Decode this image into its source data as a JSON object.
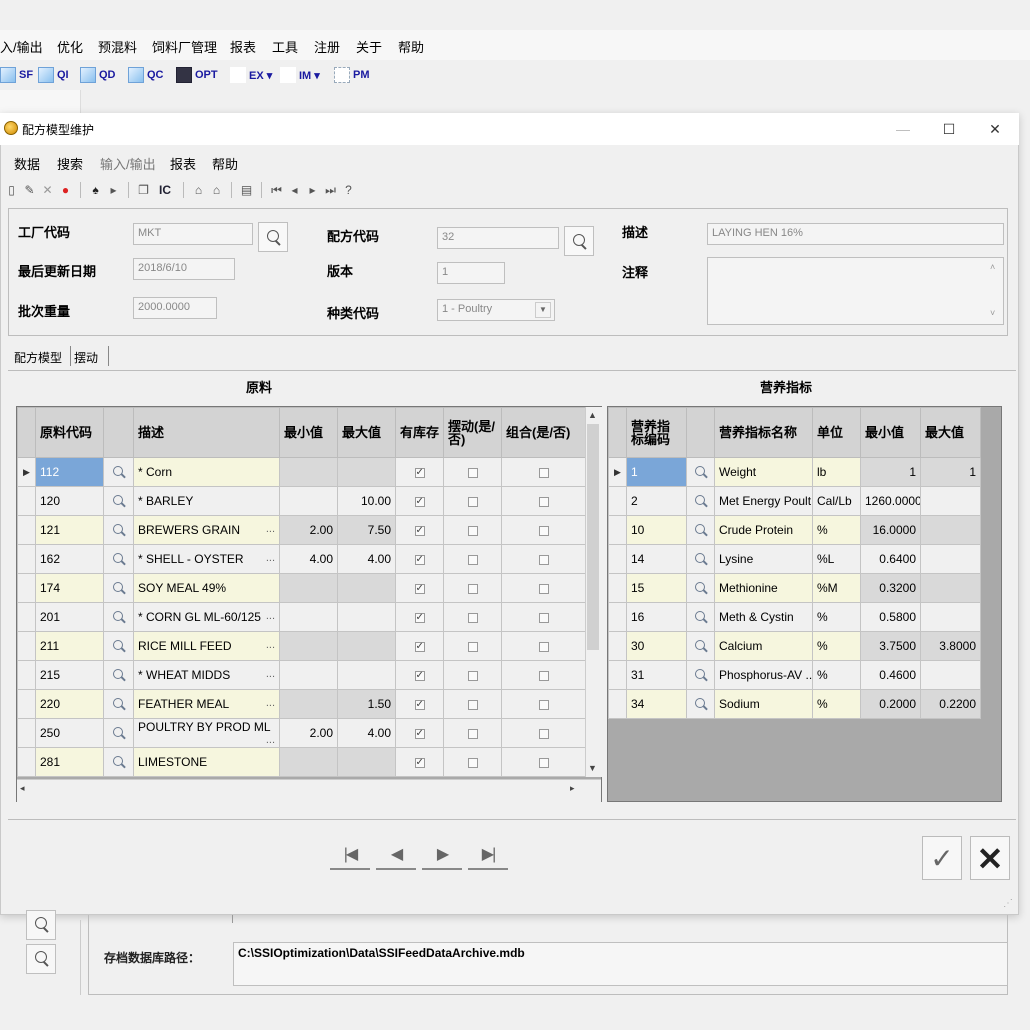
{
  "bg_menu": [
    "入/输出",
    "优化",
    "预混料",
    "饲料厂管理",
    "报表",
    "工具",
    "注册",
    "关于",
    "帮助"
  ],
  "bg_toolbar": [
    "SF",
    "QI",
    "QD",
    "QC",
    "OPT",
    "EX ▾",
    "IM ▾",
    "PM"
  ],
  "dialog": {
    "title": "配方模型维护",
    "menu": [
      "数据",
      "搜索",
      "输入/输出",
      "报表",
      "帮助"
    ],
    "ic_label": "IC"
  },
  "header": {
    "plant_code_label": "工厂代码",
    "plant_code": "MKT",
    "formula_code_label": "配方代码",
    "formula_code": "32",
    "description_label": "描述",
    "description": "LAYING HEN 16%",
    "last_update_label": "最后更新日期",
    "last_update": "2018/6/10",
    "version_label": "版本",
    "version": "1",
    "note_label": "注释",
    "note": "",
    "batch_weight_label": "批次重量",
    "batch_weight": "2000.0000",
    "category_label": "种类代码",
    "category": "1 - Poultry"
  },
  "tabs": [
    "配方模型",
    "摆动"
  ],
  "ingredients": {
    "title": "原料",
    "columns": [
      "原料代码",
      "",
      "描述",
      "最小值",
      "最大值",
      "有库存",
      "摆动(是/否)",
      "组合(是/否)"
    ],
    "rows": [
      {
        "code": "112",
        "desc": "* Corn",
        "min": "",
        "max": "",
        "stock": true,
        "swing": false,
        "combo": false,
        "ell": false
      },
      {
        "code": "120",
        "desc": "* BARLEY",
        "min": "",
        "max": "10.00",
        "stock": true,
        "swing": false,
        "combo": false,
        "ell": false
      },
      {
        "code": "121",
        "desc": "BREWERS GRAIN",
        "min": "2.00",
        "max": "7.50",
        "stock": true,
        "swing": false,
        "combo": false,
        "ell": true
      },
      {
        "code": "162",
        "desc": "* SHELL - OYSTER",
        "min": "4.00",
        "max": "4.00",
        "stock": true,
        "swing": false,
        "combo": false,
        "ell": true
      },
      {
        "code": "174",
        "desc": "SOY MEAL 49%",
        "min": "",
        "max": "",
        "stock": true,
        "swing": false,
        "combo": false,
        "ell": false
      },
      {
        "code": "201",
        "desc": "* CORN GL ML-60/125",
        "min": "",
        "max": "",
        "stock": true,
        "swing": false,
        "combo": false,
        "ell": true
      },
      {
        "code": "211",
        "desc": "RICE MILL FEED",
        "min": "",
        "max": "",
        "stock": true,
        "swing": false,
        "combo": false,
        "ell": true
      },
      {
        "code": "215",
        "desc": "* WHEAT MIDDS",
        "min": "",
        "max": "",
        "stock": true,
        "swing": false,
        "combo": false,
        "ell": true
      },
      {
        "code": "220",
        "desc": "FEATHER MEAL",
        "min": "",
        "max": "1.50",
        "stock": true,
        "swing": false,
        "combo": false,
        "ell": true
      },
      {
        "code": "250",
        "desc": "POULTRY BY PROD ML",
        "min": "2.00",
        "max": "4.00",
        "stock": true,
        "swing": false,
        "combo": false,
        "ell": true
      },
      {
        "code": "281",
        "desc": "LIMESTONE",
        "min": "",
        "max": "",
        "stock": true,
        "swing": false,
        "combo": false,
        "ell": false
      }
    ]
  },
  "nutrients": {
    "title": "营养指标",
    "columns": [
      "营养指标编码",
      "",
      "营养指标名称",
      "单位",
      "最小值",
      "最大值"
    ],
    "rows": [
      {
        "code": "1",
        "name": "Weight",
        "unit": "lb",
        "min": "1",
        "max": "1"
      },
      {
        "code": "2",
        "name": "Met Energy Poult...",
        "unit": "Cal/Lb",
        "min": "1260.0000",
        "max": ""
      },
      {
        "code": "10",
        "name": "Crude Protein",
        "unit": "%",
        "min": "16.0000",
        "max": ""
      },
      {
        "code": "14",
        "name": "Lysine",
        "unit": "%L",
        "min": "0.6400",
        "max": ""
      },
      {
        "code": "15",
        "name": "Methionine",
        "unit": "%M",
        "min": "0.3200",
        "max": ""
      },
      {
        "code": "16",
        "name": "Meth & Cystin",
        "unit": "%",
        "min": "0.5800",
        "max": ""
      },
      {
        "code": "30",
        "name": "Calcium",
        "unit": "%",
        "min": "3.7500",
        "max": "3.8000"
      },
      {
        "code": "31",
        "name": "Phosphorus-AV ...",
        "unit": "%",
        "min": "0.4600",
        "max": ""
      },
      {
        "code": "34",
        "name": "Sodium",
        "unit": "%",
        "min": "0.2000",
        "max": "0.2200"
      }
    ]
  },
  "bottom": {
    "archive_label": "存档数据库路径：",
    "archive_path": "C:\\SSIOptimization\\Data\\SSIFeedDataArchive.mdb"
  }
}
